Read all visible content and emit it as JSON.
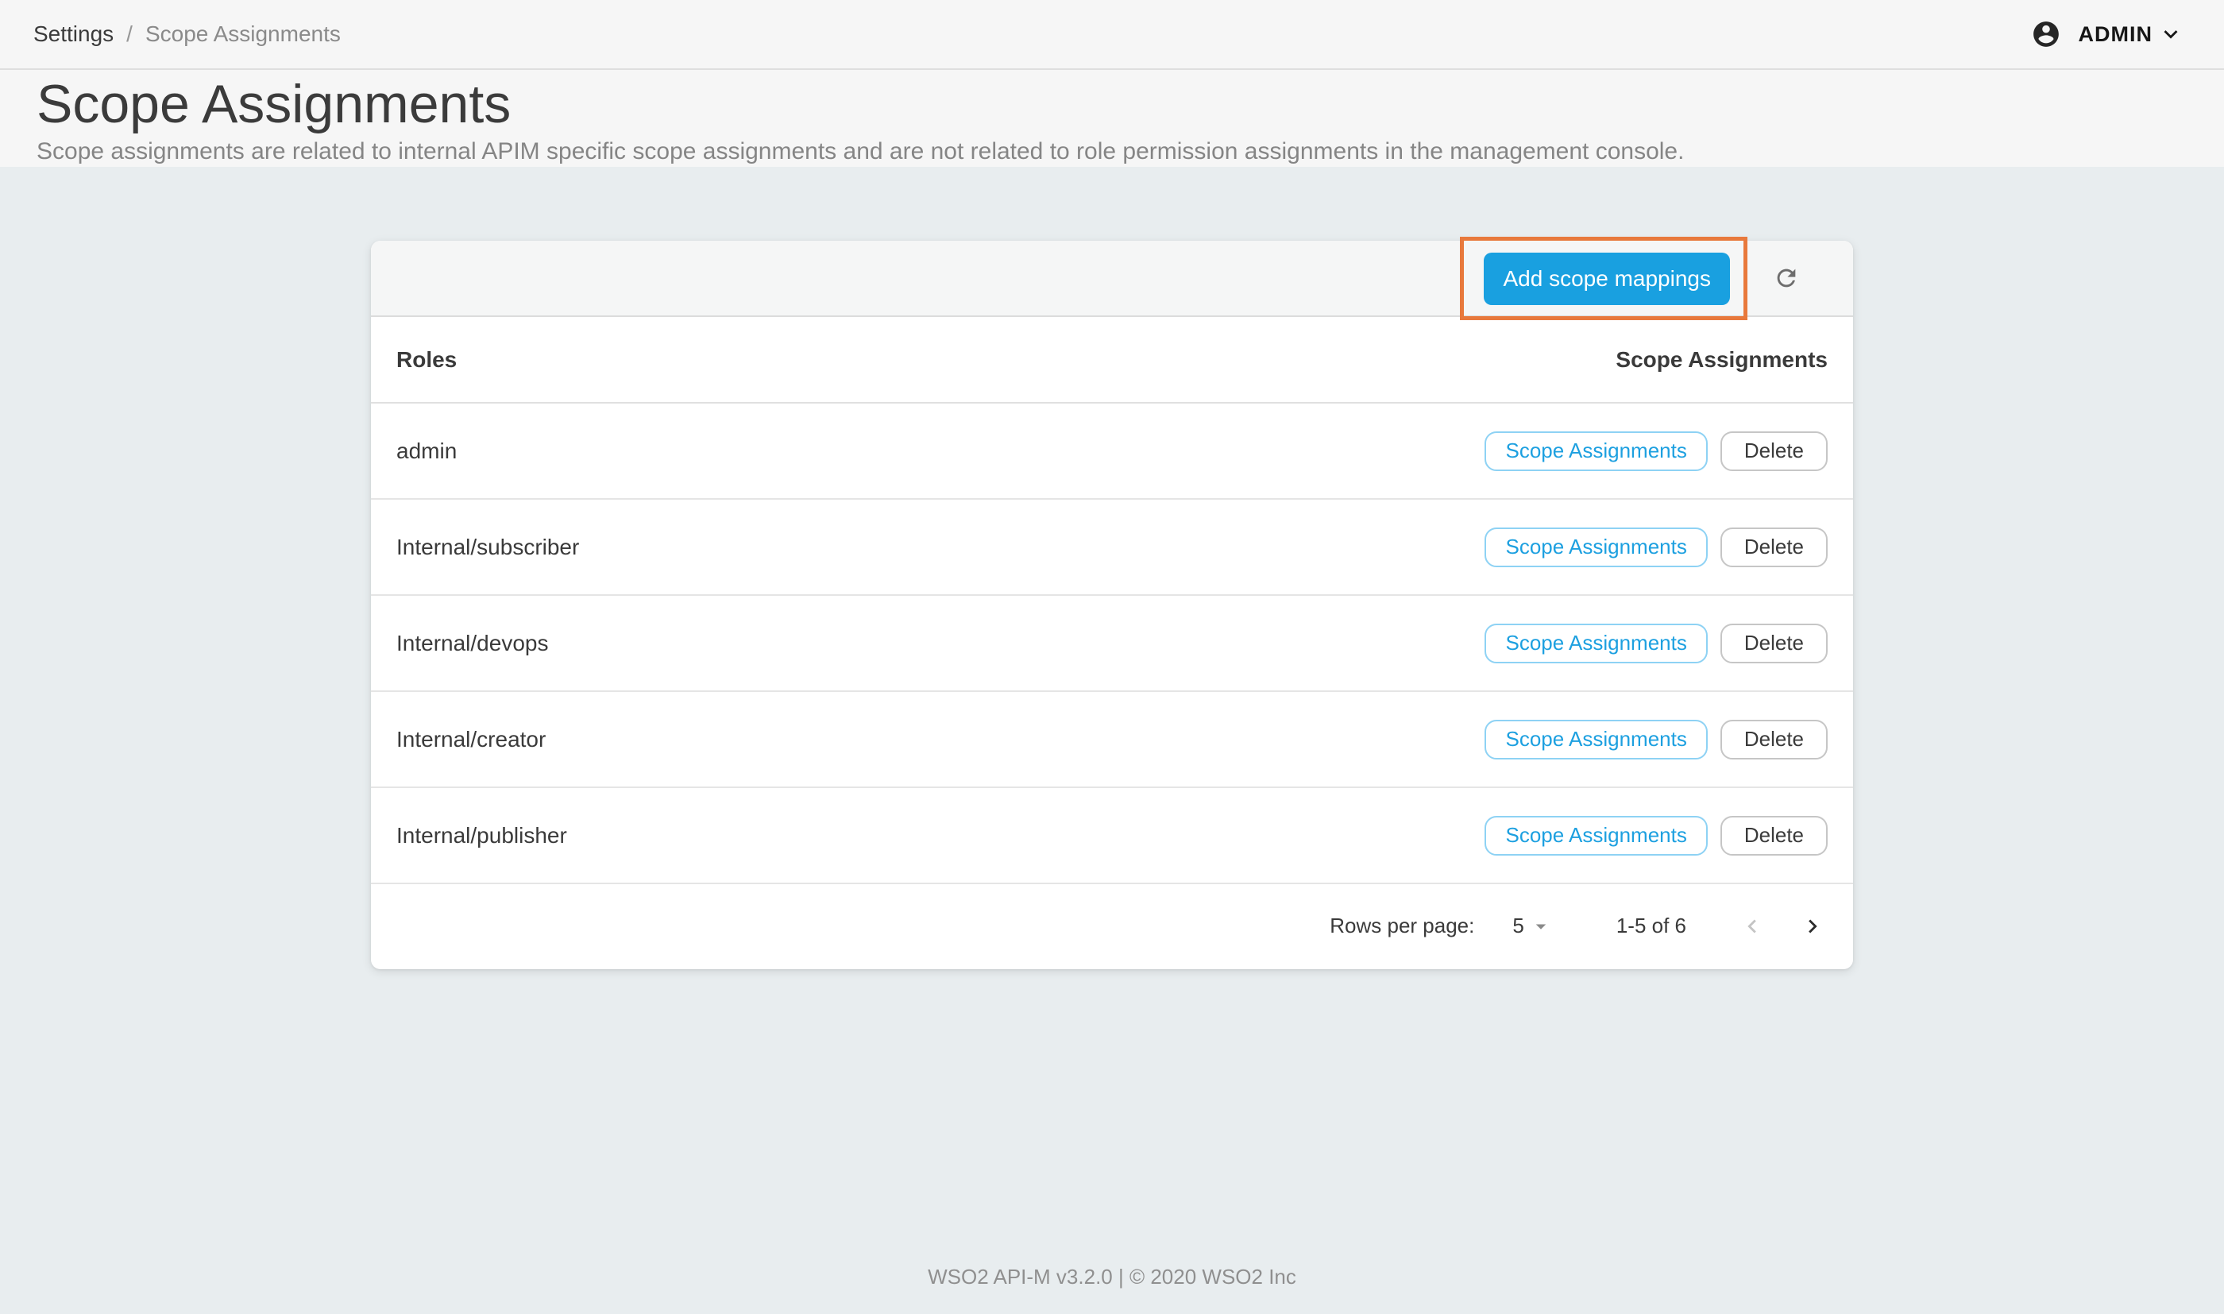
{
  "topbar": {
    "breadcrumb": {
      "parent": "Settings",
      "separator": "/",
      "current": "Scope Assignments"
    },
    "user_menu": {
      "label": "ADMIN"
    }
  },
  "page_header": {
    "title": "Scope Assignments",
    "subtitle": "Scope assignments are related to internal APIM specific scope assignments and are not related to role permission assignments in the management console."
  },
  "card": {
    "toolbar": {
      "add_button_label": "Add scope mappings"
    },
    "table": {
      "columns": [
        "Roles",
        "Scope Assignments"
      ],
      "rows": [
        {
          "role": "admin"
        },
        {
          "role": "Internal/subscriber"
        },
        {
          "role": "Internal/devops"
        },
        {
          "role": "Internal/creator"
        },
        {
          "role": "Internal/publisher"
        }
      ],
      "row_actions": {
        "scope_label": "Scope Assignments",
        "delete_label": "Delete"
      }
    },
    "pagination": {
      "rows_per_page_label": "Rows per page:",
      "rows_per_page_value": "5",
      "range": "1-5 of 6"
    }
  },
  "footer": {
    "text": "WSO2 API-M v3.2.0 | © 2020 WSO2 Inc"
  },
  "icons": {
    "avatar": "account-circle-icon",
    "chevron": "chevron-down-icon",
    "refresh": "refresh-icon",
    "dropdown": "arrow-drop-down-icon",
    "prev": "chevron-left-icon",
    "next": "chevron-right-icon"
  },
  "colors": {
    "primary_blue": "#19a0e0",
    "outlined_blue_border": "#8ed2f4",
    "annotation_orange": "#e8793c",
    "page_background": "#e8edef",
    "surface_gray": "#f6f6f6"
  }
}
